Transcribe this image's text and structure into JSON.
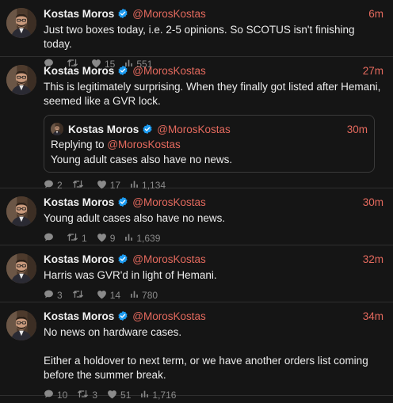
{
  "tweets": [
    {
      "name": "Kostas Moros",
      "handle": "@MorosKostas",
      "time": "6m",
      "text": "Just two boxes today, i.e. 2-5 opinions. So SCOTUS isn't finishing today.",
      "replies": "",
      "retweets": "",
      "likes": "15",
      "views": "551"
    },
    {
      "name": "Kostas Moros",
      "handle": "@MorosKostas",
      "time": "27m",
      "text": "This is legitimately surprising. When they finally got listed after Hemani, seemed like a GVR lock.",
      "replies": "2",
      "retweets": "",
      "likes": "17",
      "views": "1,134",
      "quote": {
        "name": "Kostas Moros",
        "handle": "@MorosKostas",
        "time": "30m",
        "replying_prefix": "Replying to",
        "replying_handle": "@MorosKostas",
        "text": "Young adult cases also have no news."
      }
    },
    {
      "name": "Kostas Moros",
      "handle": "@MorosKostas",
      "time": "30m",
      "text": "Young adult cases also have no news.",
      "replies": "",
      "retweets": "1",
      "likes": "9",
      "views": "1,639"
    },
    {
      "name": "Kostas Moros",
      "handle": "@MorosKostas",
      "time": "32m",
      "text": "Harris was GVR'd in light of Hemani.",
      "replies": "3",
      "retweets": "",
      "likes": "14",
      "views": "780"
    },
    {
      "name": "Kostas Moros",
      "handle": "@MorosKostas",
      "time": "34m",
      "text": "No news on hardware cases.\n\nEither a holdover to next term, or we have another orders list coming before the summer break.",
      "replies": "10",
      "retweets": "3",
      "likes": "51",
      "views": "1,716"
    }
  ],
  "colors": {
    "background": "#151515",
    "accent": "#e56a5e",
    "verified": "#1d9bf0",
    "muted": "#8a8a8a",
    "divider": "#2f2f2f"
  },
  "icons": {
    "reply": "reply-icon",
    "retweet": "retweet-icon",
    "like": "heart-icon",
    "views": "views-icon",
    "verified": "verified-badge-icon"
  }
}
